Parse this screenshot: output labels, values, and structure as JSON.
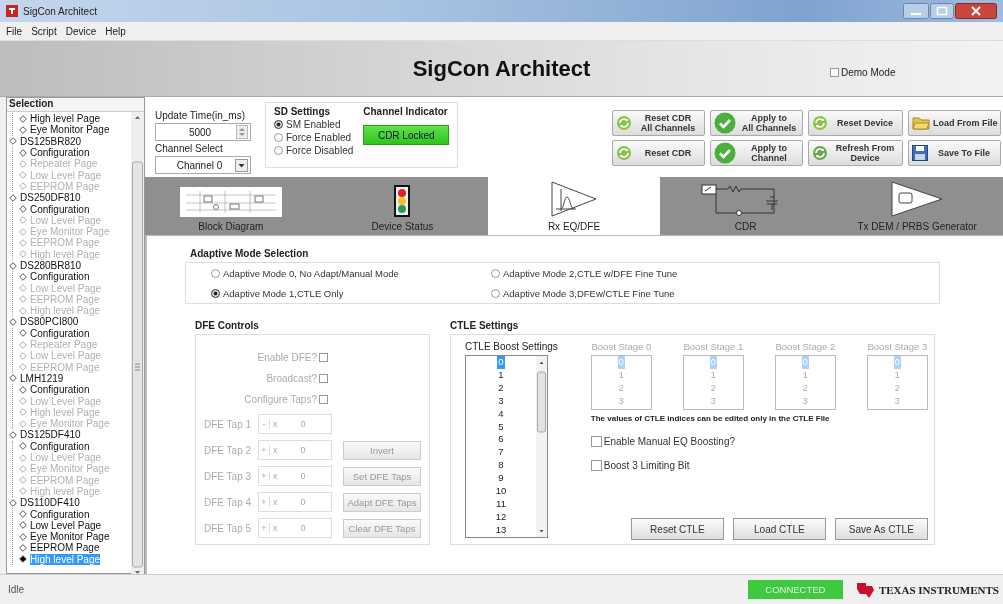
{
  "window": {
    "title": "SigCon Architect"
  },
  "menu": [
    "File",
    "Script",
    "Device",
    "Help"
  ],
  "header": {
    "title": "SigCon Architect",
    "demo_mode": {
      "label": "Demo Mode",
      "checked": false
    }
  },
  "sidebar": {
    "title": "Selection",
    "tree": [
      {
        "children": [
          {
            "label": "High level Page",
            "disabled": false,
            "selected": false
          },
          {
            "label": "Eye Monitor Page",
            "disabled": false,
            "selected": false
          }
        ]
      },
      {
        "label": "DS125BR820",
        "disabled": false,
        "selected": false,
        "children": [
          {
            "label": "Configuration",
            "disabled": false,
            "selected": false
          },
          {
            "label": "Repeater Page",
            "disabled": true,
            "selected": false
          },
          {
            "label": "Low Level Page",
            "disabled": true,
            "selected": false
          },
          {
            "label": "EEPROM Page",
            "disabled": true,
            "selected": false
          }
        ]
      },
      {
        "label": "DS250DF810",
        "disabled": false,
        "selected": false,
        "children": [
          {
            "label": "Configuration",
            "disabled": false,
            "selected": false
          },
          {
            "label": "Low Level Page",
            "disabled": true,
            "selected": false
          },
          {
            "label": "Eye Monitor Page",
            "disabled": true,
            "selected": false
          },
          {
            "label": "EEPROM Page",
            "disabled": true,
            "selected": false
          },
          {
            "label": "High level Page",
            "disabled": true,
            "selected": false
          }
        ]
      },
      {
        "label": "DS280BR810",
        "disabled": false,
        "selected": false,
        "children": [
          {
            "label": "Configuration",
            "disabled": false,
            "selected": false
          },
          {
            "label": "Low Level Page",
            "disabled": true,
            "selected": false
          },
          {
            "label": "EEPROM Page",
            "disabled": true,
            "selected": false
          },
          {
            "label": "High level Page",
            "disabled": true,
            "selected": false
          }
        ]
      },
      {
        "label": "DS80PCI800",
        "disabled": false,
        "selected": false,
        "children": [
          {
            "label": "Configuration",
            "disabled": false,
            "selected": false
          },
          {
            "label": "Repeater Page",
            "disabled": true,
            "selected": false
          },
          {
            "label": "Low Level Page",
            "disabled": true,
            "selected": false
          },
          {
            "label": "EEPROM Page",
            "disabled": true,
            "selected": false
          }
        ]
      },
      {
        "label": "LMH1219",
        "disabled": false,
        "selected": false,
        "children": [
          {
            "label": "Configuration",
            "disabled": false,
            "selected": false
          },
          {
            "label": "Low Level Page",
            "disabled": true,
            "selected": false
          },
          {
            "label": "High level Page",
            "disabled": true,
            "selected": false
          },
          {
            "label": "Eye Monitor Page",
            "disabled": true,
            "selected": false
          }
        ]
      },
      {
        "label": "DS125DF410",
        "disabled": false,
        "selected": false,
        "children": [
          {
            "label": "Configuration",
            "disabled": false,
            "selected": false
          },
          {
            "label": "Low Level Page",
            "disabled": true,
            "selected": false
          },
          {
            "label": "Eye Monitor Page",
            "disabled": true,
            "selected": false
          },
          {
            "label": "EEPROM Page",
            "disabled": true,
            "selected": false
          },
          {
            "label": "High level Page",
            "disabled": true,
            "selected": false
          }
        ]
      },
      {
        "label": "DS110DF410",
        "disabled": false,
        "selected": false,
        "children": [
          {
            "label": "Configuration",
            "disabled": false,
            "selected": false
          },
          {
            "label": "Low Level Page",
            "disabled": false,
            "selected": false
          },
          {
            "label": "Eye Monitor Page",
            "disabled": false,
            "selected": false
          },
          {
            "label": "EEPROM Page",
            "disabled": false,
            "selected": false
          },
          {
            "label": "High level Page",
            "disabled": false,
            "selected": true
          }
        ]
      }
    ]
  },
  "update_time": {
    "label": "Update Time(in_ms)",
    "value": "5000"
  },
  "channel_select": {
    "label": "Channel Select",
    "value": "Channel 0"
  },
  "sd_settings": {
    "title": "SD Settings",
    "options": [
      {
        "label": "SM Enabled",
        "selected": true
      },
      {
        "label": "Force Enabled",
        "selected": false
      },
      {
        "label": "Force Disabled",
        "selected": false
      }
    ]
  },
  "channel_indicator": {
    "title": "Channel Indicator",
    "status": "CDR Locked",
    "on": true
  },
  "actions": [
    {
      "kind": "reset",
      "lines": [
        "Reset CDR",
        "All Channels"
      ]
    },
    {
      "kind": "apply",
      "lines": [
        "Apply to",
        "All Channels"
      ]
    },
    {
      "kind": "reset",
      "lines": [
        "Reset Device"
      ]
    },
    {
      "kind": "load",
      "lines": [
        "Load From File"
      ]
    },
    {
      "kind": "reset",
      "lines": [
        "Reset CDR"
      ]
    },
    {
      "kind": "apply",
      "lines": [
        "Apply to",
        "Channel"
      ]
    },
    {
      "kind": "refresh",
      "lines": [
        "Refresh From",
        "Device"
      ]
    },
    {
      "kind": "save",
      "lines": [
        "Save To File"
      ]
    }
  ],
  "tabs": [
    {
      "kind": "block_diagram",
      "label": "Block Diagram",
      "selected": false
    },
    {
      "kind": "traffic_light",
      "label": "Device Status",
      "selected": false
    },
    {
      "kind": "amplifier",
      "label": "Rx EQ/DFE",
      "selected": true
    },
    {
      "kind": "circuit",
      "label": "CDR",
      "selected": false
    },
    {
      "kind": "transmitter",
      "label": "Tx DEM / PRBS Generator",
      "selected": false
    }
  ],
  "adaptive_mode": {
    "title": "Adaptive Mode Selection",
    "options": [
      {
        "label": "Adaptive Mode 0, No Adapt/Manual Mode",
        "selected": false
      },
      {
        "label": "Adaptive Mode 1,CTLE Only",
        "selected": true
      },
      {
        "label": "Adaptive Mode 2,CTLE w/DFE Fine Tune",
        "selected": false
      },
      {
        "label": "Adaptive Mode 3,DFEw/CTLE Fine Tune",
        "selected": false
      }
    ]
  },
  "dfe_controls": {
    "title": "DFE Controls",
    "disabled": true,
    "checks": [
      {
        "label": "Enable DFE?",
        "checked": false
      },
      {
        "label": "Broadcast?",
        "checked": false
      },
      {
        "label": "Configure Taps?",
        "checked": false
      }
    ],
    "taps": [
      {
        "label": "DFE Tap 1",
        "sign": "-",
        "unit": "x",
        "value": "0"
      },
      {
        "label": "DFE Tap 2",
        "sign": "+",
        "unit": "x",
        "value": "0",
        "button": "Invert"
      },
      {
        "label": "DFE Tap 3",
        "sign": "+",
        "unit": "x",
        "value": "0",
        "button": "Set DFE Taps"
      },
      {
        "label": "DFE Tap 4",
        "sign": "+",
        "unit": "x",
        "value": "0",
        "button": "Adapt DFE Taps"
      },
      {
        "label": "DFE Tap 5",
        "sign": "+",
        "unit": "x",
        "value": "0",
        "button": "Clear DFE Taps"
      }
    ]
  },
  "ctle": {
    "title": "CTLE Settings",
    "boost_settings": {
      "title": "CTLE Boost Settings",
      "items": [
        {
          "label": "0",
          "selected": true
        },
        {
          "label": "1",
          "selected": false
        },
        {
          "label": "2",
          "selected": false
        },
        {
          "label": "3",
          "selected": false
        },
        {
          "label": "4",
          "selected": false
        },
        {
          "label": "5",
          "selected": false
        },
        {
          "label": "6",
          "selected": false
        },
        {
          "label": "7",
          "selected": false
        },
        {
          "label": "8",
          "selected": false
        },
        {
          "label": "9",
          "selected": false
        },
        {
          "label": "10",
          "selected": false
        },
        {
          "label": "11",
          "selected": false
        },
        {
          "label": "12",
          "selected": false
        },
        {
          "label": "13",
          "selected": false
        }
      ]
    },
    "stages": [
      {
        "title": "Boost Stage 0",
        "disabled": true,
        "items": [
          {
            "label": "0",
            "selected": true
          },
          {
            "label": "1",
            "selected": false
          },
          {
            "label": "2",
            "selected": false
          },
          {
            "label": "3",
            "selected": false
          }
        ]
      },
      {
        "title": "Boost Stage 1",
        "disabled": true,
        "items": [
          {
            "label": "0",
            "selected": true
          },
          {
            "label": "1",
            "selected": false
          },
          {
            "label": "2",
            "selected": false
          },
          {
            "label": "3",
            "selected": false
          }
        ]
      },
      {
        "title": "Boost Stage 2",
        "disabled": true,
        "items": [
          {
            "label": "0",
            "selected": true
          },
          {
            "label": "1",
            "selected": false
          },
          {
            "label": "2",
            "selected": false
          },
          {
            "label": "3",
            "selected": false
          }
        ]
      },
      {
        "title": "Boost Stage 3",
        "disabled": true,
        "items": [
          {
            "label": "0",
            "selected": true
          },
          {
            "label": "1",
            "selected": false
          },
          {
            "label": "2",
            "selected": false
          },
          {
            "label": "3",
            "selected": false
          }
        ]
      }
    ],
    "note": "The values of CTLE indices can be edited only in the CTLE File",
    "checks": [
      {
        "label": "Enable Manual EQ Boosting?",
        "checked": false
      },
      {
        "label": "Boost 3 Limiting Bit",
        "checked": false
      }
    ],
    "buttons": [
      "Reset CTLE",
      "Load CTLE",
      "Save As CTLE"
    ]
  },
  "status_bar": {
    "text": "Idle",
    "connection": "CONNECTED",
    "connected": true,
    "brand": "TEXAS INSTRUMENTS"
  }
}
